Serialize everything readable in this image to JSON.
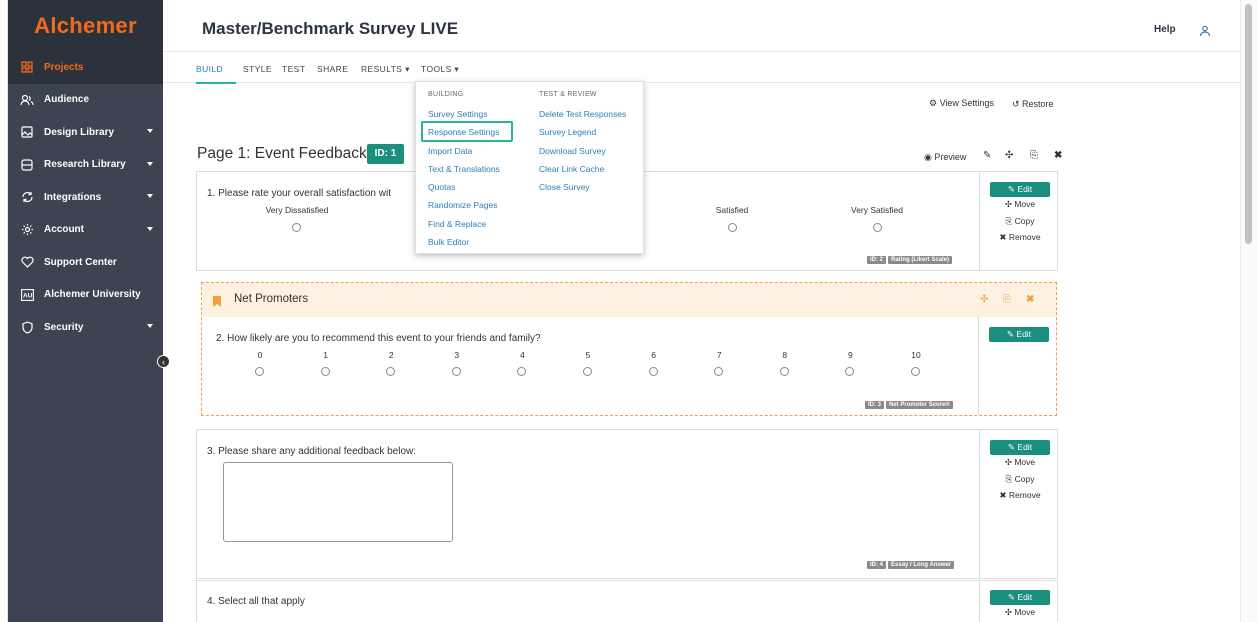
{
  "brand": {
    "name": "Alchemer",
    "accent": "#f26b1d",
    "teal": "#1b8f7d"
  },
  "sidebar": {
    "items": [
      {
        "label": "Projects",
        "icon": "grid-icon",
        "active": true
      },
      {
        "label": "Audience",
        "icon": "people-icon"
      },
      {
        "label": "Design Library",
        "icon": "image-icon",
        "caret": true
      },
      {
        "label": "Research Library",
        "icon": "database-icon",
        "caret": true
      },
      {
        "label": "Integrations",
        "icon": "refresh-icon",
        "caret": true
      },
      {
        "label": "Account",
        "icon": "gear-icon",
        "caret": true
      },
      {
        "label": "Support Center",
        "icon": "heart-icon"
      },
      {
        "label": "Alchemer University",
        "icon": "au-icon"
      },
      {
        "label": "Security",
        "icon": "shield-icon",
        "caret": true
      }
    ],
    "collapse_glyph": "‹"
  },
  "header": {
    "title": "Master/Benchmark Survey LIVE",
    "help": "Help"
  },
  "tabs": {
    "build": "BUILD",
    "style": "STYLE",
    "test": "TEST",
    "share": "SHARE",
    "results": "RESULTS ▾",
    "tools": "TOOLS ▾"
  },
  "toolbar": {
    "view_settings": "⚙ View Settings",
    "restore": "↺ Restore"
  },
  "page": {
    "title": "Page 1: Event Feedback",
    "id": "ID: 1",
    "preview": "◉ Preview"
  },
  "dropdown": {
    "building_header": "BUILDING",
    "test_header": "TEST & REVIEW",
    "building": [
      "Survey Settings",
      "Response Settings",
      "Import Data",
      "Text & Translations",
      "Quotas",
      "Randomize Pages",
      "Find & Replace",
      "Bulk Editor"
    ],
    "test": [
      "Delete Test Responses",
      "Survey Legend",
      "Download Survey",
      "Clear Link Cache",
      "Close Survey"
    ]
  },
  "q1": {
    "text": "1. Please rate your overall satisfaction wit",
    "scale": [
      "Very Dissatisfied",
      "Satisfied",
      "Very Satisfied"
    ],
    "id_tag": "ID: 2",
    "type_tag": "Rating (Likert Scale)"
  },
  "np": {
    "title": "Net Promoters"
  },
  "q2": {
    "text": "2. How likely are you to recommend this event to your friends and family?",
    "scale": [
      "0",
      "1",
      "2",
      "3",
      "4",
      "5",
      "6",
      "7",
      "8",
      "9",
      "10"
    ],
    "id_tag": "ID: 3",
    "type_tag": "Net Promoter Score®"
  },
  "q3": {
    "text": "3. Please share any additional feedback below:",
    "id_tag": "ID: 4",
    "type_tag": "Essay / Long Answer"
  },
  "q4": {
    "text": "4. Select all that apply"
  },
  "actions": {
    "edit": "✎ Edit",
    "move": "✣ Move",
    "copy": "⎘ Copy",
    "remove": "✖ Remove"
  }
}
